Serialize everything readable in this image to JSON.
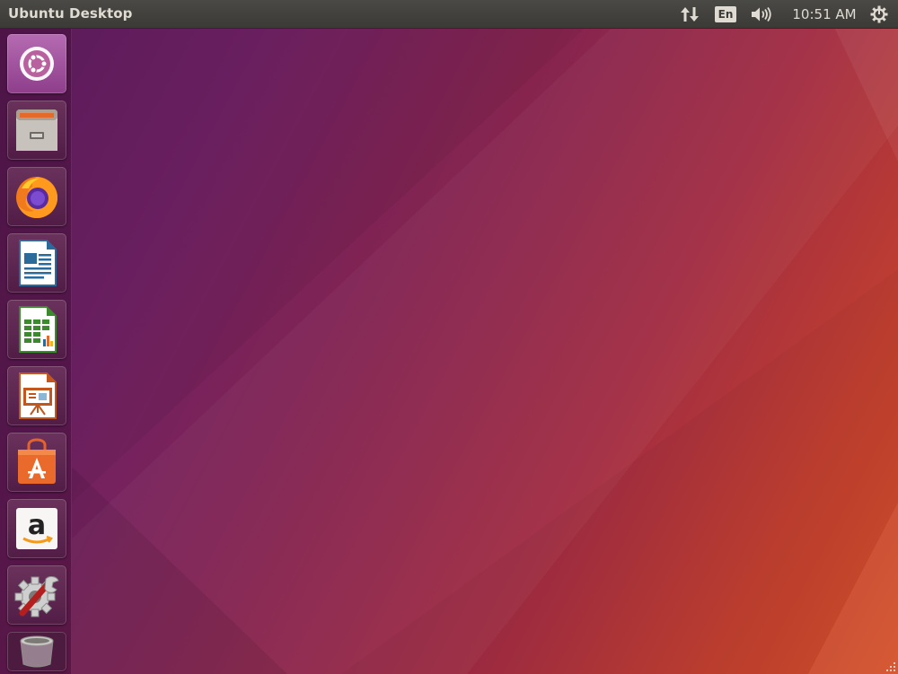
{
  "panel": {
    "title": "Ubuntu Desktop",
    "keyboard_layout": "En",
    "clock": "10:51 AM"
  },
  "launcher": {
    "items": [
      {
        "icon": "ubuntu-dash-icon"
      },
      {
        "icon": "file-cabinet-icon"
      },
      {
        "icon": "firefox-icon"
      },
      {
        "icon": "libreoffice-writer-icon"
      },
      {
        "icon": "libreoffice-calc-icon"
      },
      {
        "icon": "libreoffice-impress-icon"
      },
      {
        "icon": "shopping-bag-icon"
      },
      {
        "icon": "amazon-icon"
      },
      {
        "icon": "gear-wrench-icon"
      },
      {
        "icon": "trash-icon"
      }
    ]
  },
  "colors": {
    "panel_bg": "#3c3b37",
    "panel_text": "#dfdbd2",
    "wallpaper_left": "#5e1c5e",
    "wallpaper_right": "#d4522a",
    "dash_accent": "#a14f9f"
  }
}
